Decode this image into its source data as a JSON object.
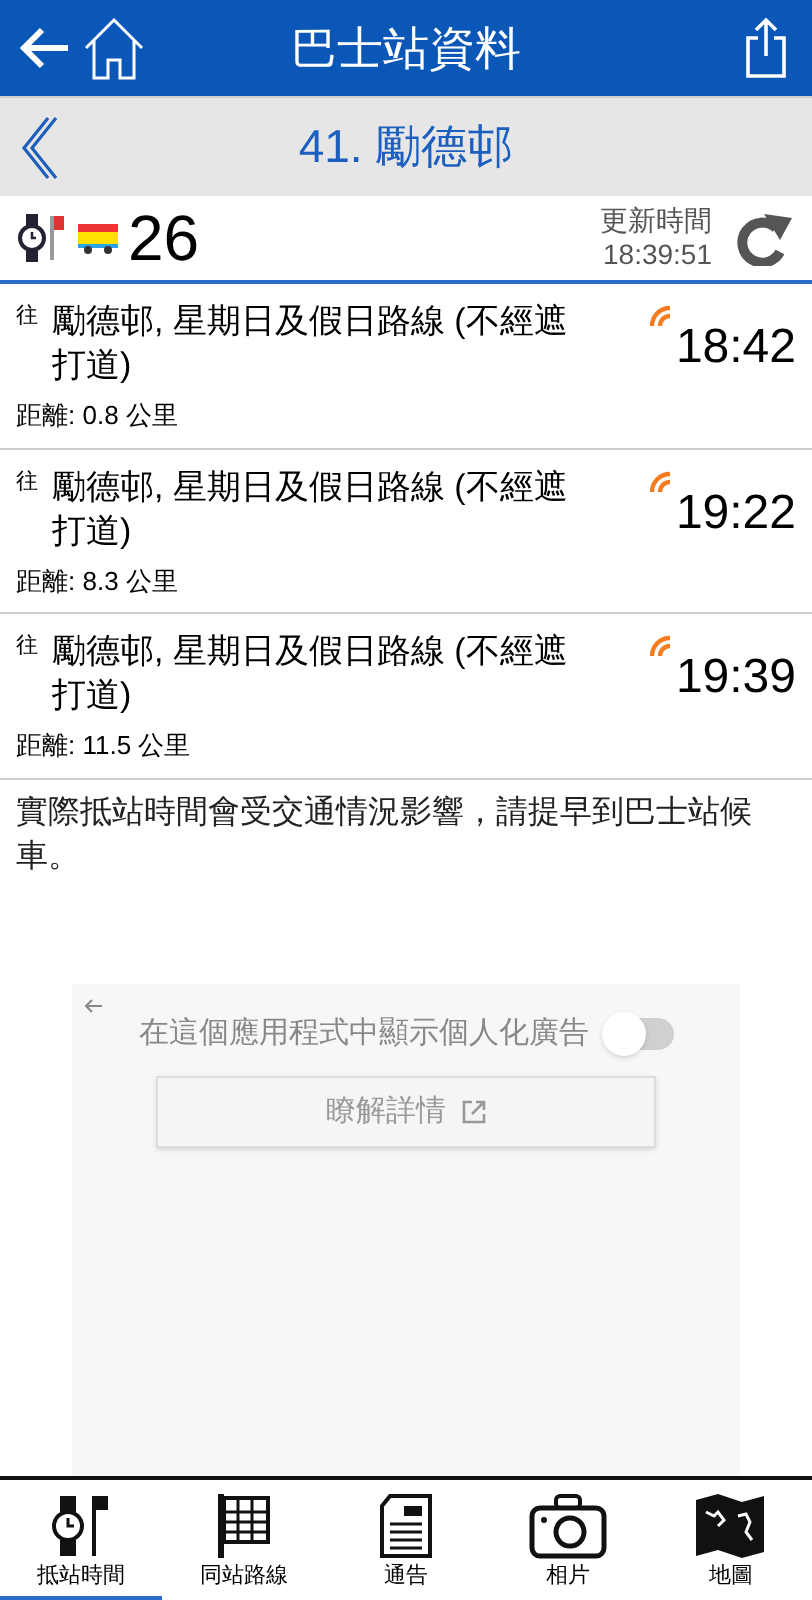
{
  "header": {
    "title": "巴士站資料"
  },
  "stop": {
    "title": "41. 勵德邨"
  },
  "info": {
    "route": "26",
    "updated_label": "更新時間",
    "updated_time": "18:39:51"
  },
  "arrivals": [
    {
      "prefix": "往",
      "destination": "勵德邨, 星期日及假日路線 (不經遮打道)",
      "distance": "距離: 0.8 公里",
      "time": "18:42",
      "live": true
    },
    {
      "prefix": "往",
      "destination": "勵德邨, 星期日及假日路線 (不經遮打道)",
      "distance": "距離: 8.3 公里",
      "time": "19:22",
      "live": true
    },
    {
      "prefix": "往",
      "destination": "勵德邨, 星期日及假日路線 (不經遮打道)",
      "distance": "距離: 11.5 公里",
      "time": "19:39",
      "live": true
    }
  ],
  "notice": "實際抵站時間會受交通情況影響，請提早到巴士站候車。",
  "ad": {
    "toggle_label": "在這個應用程式中顯示個人化廣告",
    "toggle_on": false,
    "button": "瞭解詳情"
  },
  "tabs": [
    {
      "kind": "eta",
      "label": "抵站時間",
      "selected": true
    },
    {
      "kind": "routes",
      "label": "同站路線",
      "selected": false
    },
    {
      "kind": "notice",
      "label": "通告",
      "selected": false
    },
    {
      "kind": "photo",
      "label": "相片",
      "selected": false
    },
    {
      "kind": "map",
      "label": "地圖",
      "selected": false
    }
  ]
}
